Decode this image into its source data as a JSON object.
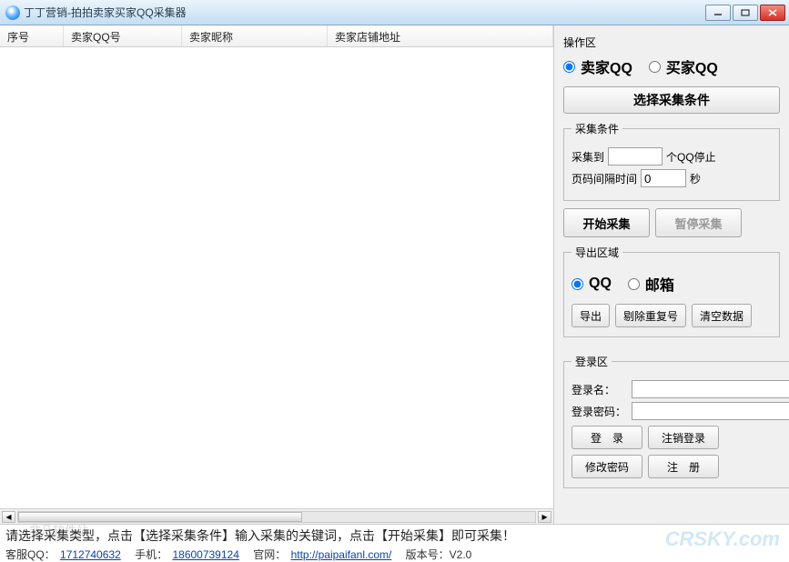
{
  "window": {
    "title": "丁丁营销-拍拍卖家买家QQ采集器"
  },
  "table": {
    "columns": [
      "序号",
      "卖家QQ号",
      "卖家昵称",
      "卖家店铺地址"
    ]
  },
  "side": {
    "operate_title": "操作区",
    "seller_qq_label": "卖家QQ",
    "buyer_qq_label": "买家QQ",
    "select_cond_btn": "选择采集条件",
    "cond_legend": "采集条件",
    "collect_to_label": "采集到",
    "collect_to_value": "",
    "qq_stop_suffix": "个QQ停止",
    "interval_label": "页码间隔时间",
    "interval_value": "0",
    "interval_suffix": "秒",
    "start_btn": "开始采集",
    "pause_btn": "暂停采集",
    "export_legend": "导出区域",
    "export_qq_label": "QQ",
    "export_mail_label": "邮箱",
    "export_btn": "导出",
    "dedupe_btn": "剔除重复号",
    "clear_btn": "清空数据",
    "login_legend": "登录区",
    "login_name_label": "登录名：",
    "login_name_value": "",
    "login_pwd_label": "登录密码：",
    "login_pwd_value": "",
    "login_btn": "登　录",
    "logout_btn": "注销登录",
    "chgpwd_btn": "修改密码",
    "register_btn": "注　册"
  },
  "bottom": {
    "instruction": "请选择采集类型，点击【选择采集条件】输入采集的关键词，点击【开始采集】即可采集！",
    "service_qq_label": "客服QQ：",
    "service_qq": "1712740632",
    "phone_label": "手机：",
    "phone": "18600739124",
    "site_label": "官网：",
    "site_url": "http://paipaifanl.com/",
    "version_label": "版本号：V2.0"
  },
  "watermark": {
    "cn": "非凡软件站",
    "en": "CRSKY.com"
  }
}
